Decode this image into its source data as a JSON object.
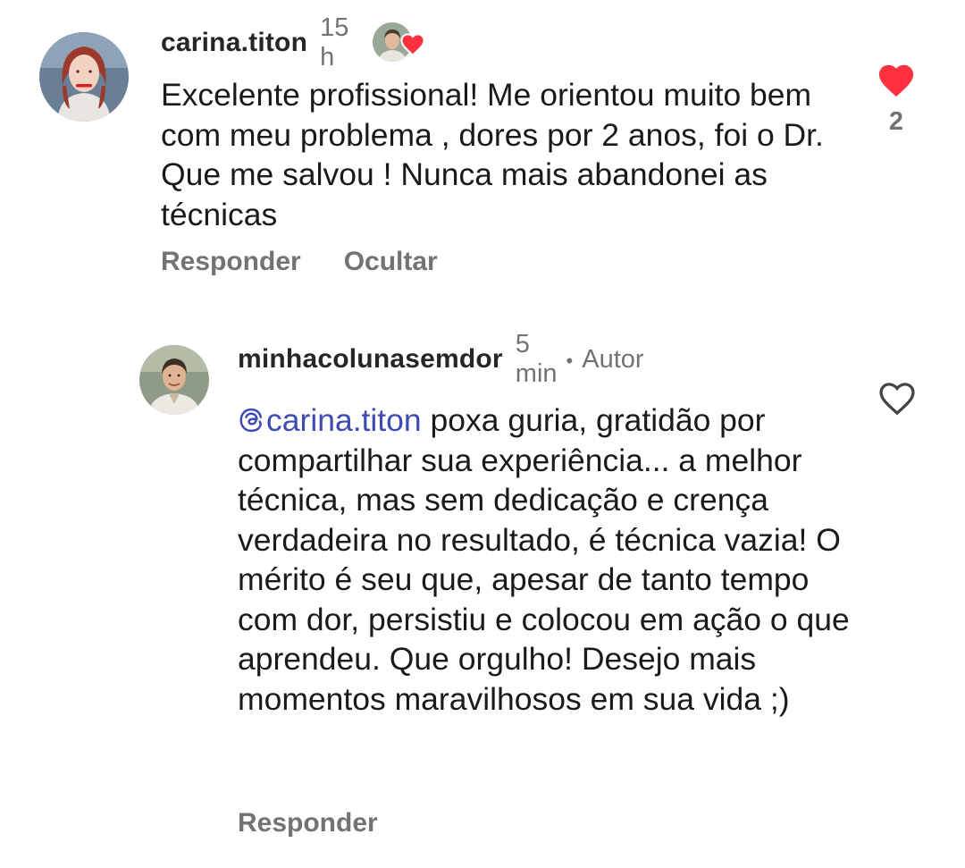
{
  "colors": {
    "heart_red": "#ff3040",
    "mention_blue": "#3f4bb5",
    "secondary_text": "#737373"
  },
  "comments": [
    {
      "username": "carina.titon",
      "time": "15 h",
      "liked_by_author_icon": "heart-icon",
      "text": "Excelente profissional! Me orientou muito bem com meu problema , dores  por 2 anos, foi o Dr. Que me salvou ! Nunca mais abandonei as técnicas",
      "actions": {
        "reply": "Responder",
        "hide": "Ocultar"
      },
      "like": {
        "icon": "heart-filled-icon",
        "liked": true,
        "count": "2"
      }
    },
    {
      "username": "minhacolunasemdor",
      "time": "5 min",
      "separator": "•",
      "badge": "Autor",
      "mention": "carina.titon",
      "mention_icon": "threads-icon",
      "text": " poxa guria, gratidão por compartilhar sua experiência... a melhor técnica, mas sem dedicação e crença verdadeira no resultado, é técnica vazia! O mérito é seu que, apesar de tanto tempo com dor, persistiu e colocou em ação o que aprendeu. Que orgulho! Desejo mais momentos maravilhosos em sua vida ;)",
      "actions": {
        "reply": "Responder"
      },
      "like": {
        "icon": "heart-outline-icon",
        "liked": false
      }
    }
  ]
}
